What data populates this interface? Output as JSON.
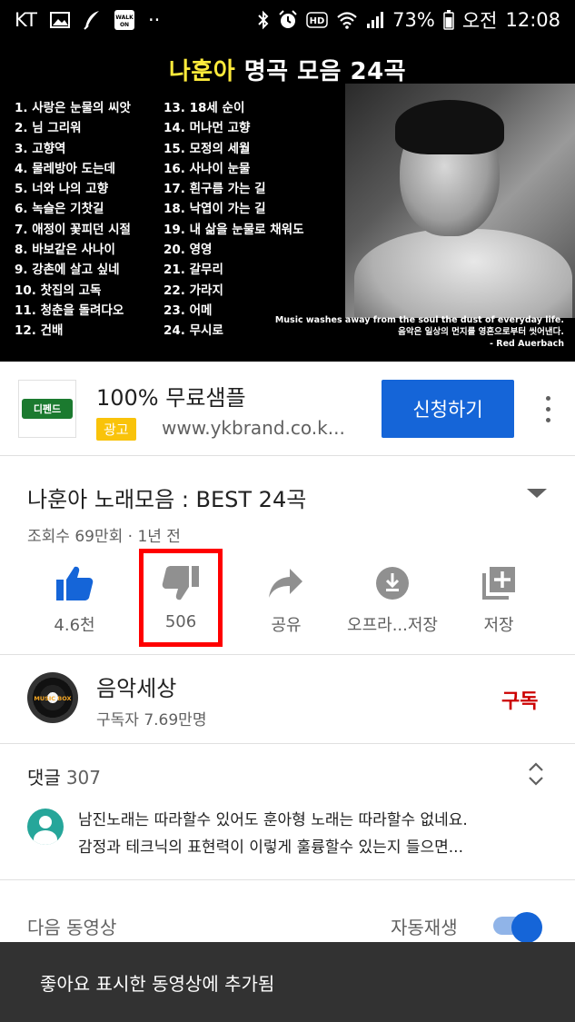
{
  "status_bar": {
    "carrier": "KT",
    "battery_percent": "73%",
    "period": "오전",
    "time": "12:08",
    "walk_badge": "WALK ON",
    "overflow": "··"
  },
  "video": {
    "title_highlight": "나훈아",
    "title_rest": " 명곡 모음 24곡",
    "tracks_left": [
      "1. 사랑은 눈물의 씨앗",
      "2. 님 그리워",
      "3. 고향역",
      "4. 물레방아 도는데",
      "5. 너와 나의 고향",
      "6. 녹슬은 기찻길",
      "7. 애정이 꽃피던 시절",
      "8. 바보같은 사나이",
      "9. 강촌에 살고 싶네",
      "10. 찻집의 고독",
      "11. 청춘을 돌려다오",
      "12. 건배"
    ],
    "tracks_right": [
      "13. 18세 순이",
      "14. 머나먼 고향",
      "15. 모정의 세월",
      "16. 사나이 눈물",
      "17. 흰구름 가는 길",
      "18. 낙엽이 가는 길",
      "19. 내 삶을 눈물로 채워도",
      "20. 영영",
      "21. 갈무리",
      "22. 가라지",
      "23. 어메",
      "24. 무시로"
    ],
    "quote_en": "Music washes away from the soul the dust of everyday life.",
    "quote_ko": "음악은 일상의 먼지를 영혼으로부터 씻어낸다.",
    "quote_author": "- Red Auerbach"
  },
  "ad": {
    "logo_text": "디펜드",
    "title": "100% 무료샘플",
    "badge": "광고",
    "url": "www.ykbrand.co.k...",
    "cta": "신청하기"
  },
  "video_info": {
    "title": "나훈아 노래모음 : BEST 24곡",
    "meta": "조회수 69만회 · 1년 전"
  },
  "actions": {
    "like": "4.6천",
    "dislike": "506",
    "share": "공유",
    "offline": "오프라...저장",
    "save": "저장"
  },
  "channel": {
    "name": "음악세상",
    "subscribers": "구독자 7.69만명",
    "subscribe": "구독",
    "avatar_text": "MUSIC BOX"
  },
  "comments": {
    "label": "댓글",
    "count": "307",
    "top_comment_line1": "남진노래는 따라할수 있어도 훈아형  노래는 따라할수 없네요.",
    "top_comment_line2": "감정과 테크닉의  표현력이  이렇게 훌륭할수 있는지 들으면..."
  },
  "up_next": {
    "label": "다음 동영상",
    "autoplay_label": "자동재생",
    "autoplay_on": true
  },
  "snackbar": {
    "message": "좋아요 표시한 동영상에 추가됨"
  },
  "colors": {
    "accent_blue": "#1565d8",
    "subscribe_red": "#cc0000",
    "highlight_red": "#ff0000",
    "title_yellow": "#ffeb3b",
    "ad_badge": "#f9c30a"
  }
}
